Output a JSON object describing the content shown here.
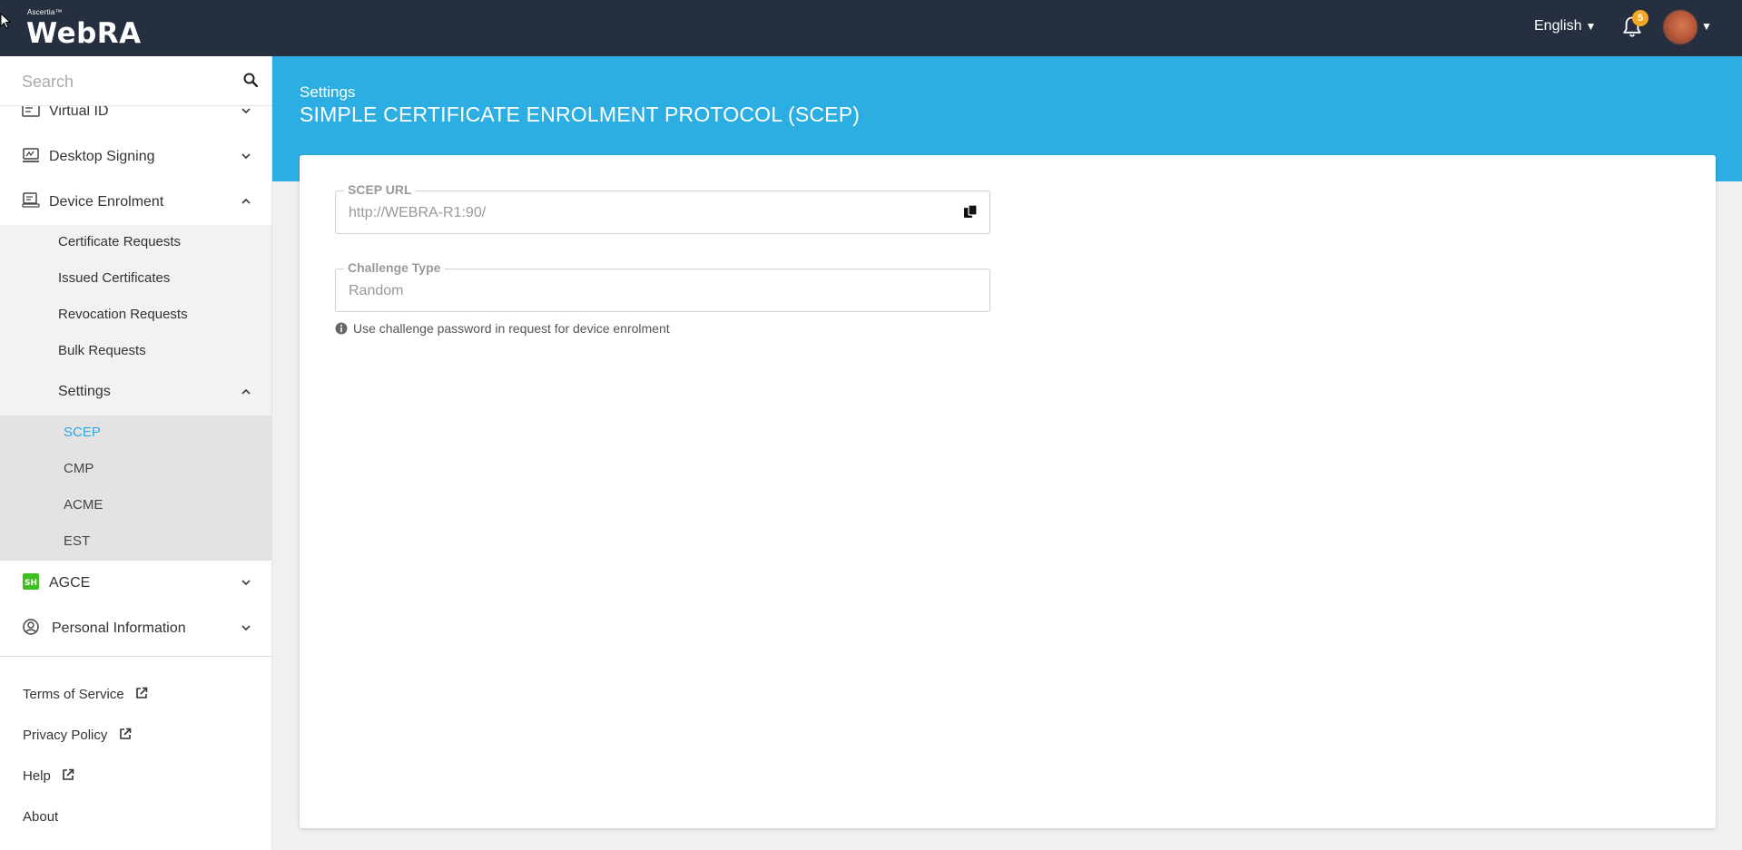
{
  "header": {
    "logo_brand": "Ascertia™",
    "logo_name": "WebRA",
    "language": "English",
    "notification_count": "5"
  },
  "search": {
    "placeholder": "Search"
  },
  "sidebar": {
    "items": [
      {
        "label": "Virtual ID"
      },
      {
        "label": "Desktop Signing"
      },
      {
        "label": "Device Enrolment"
      },
      {
        "label": "AGCE"
      },
      {
        "label": "Personal Information"
      }
    ],
    "device_enrolment_sub": [
      {
        "label": "Certificate Requests"
      },
      {
        "label": "Issued Certificates"
      },
      {
        "label": "Revocation Requests"
      },
      {
        "label": "Bulk Requests"
      },
      {
        "label": "Settings"
      }
    ],
    "settings_sub": [
      {
        "label": "SCEP",
        "active": true
      },
      {
        "label": "CMP"
      },
      {
        "label": "ACME"
      },
      {
        "label": "EST"
      }
    ],
    "footer": [
      {
        "label": "Terms of Service"
      },
      {
        "label": "Privacy Policy"
      },
      {
        "label": "Help"
      },
      {
        "label": "About"
      }
    ]
  },
  "main": {
    "breadcrumb": "Settings",
    "title": "SIMPLE CERTIFICATE ENROLMENT PROTOCOL (SCEP)",
    "scep_url": {
      "label": "SCEP URL",
      "value": "http://WEBRA-R1:90/"
    },
    "challenge_type": {
      "label": "Challenge Type",
      "value": "Random"
    },
    "hint": "Use challenge password in request for device enrolment"
  },
  "colors": {
    "topbar": "#252f3f",
    "accent": "#29abe2",
    "header_band": "#2daee3",
    "badge": "#f5a623"
  }
}
